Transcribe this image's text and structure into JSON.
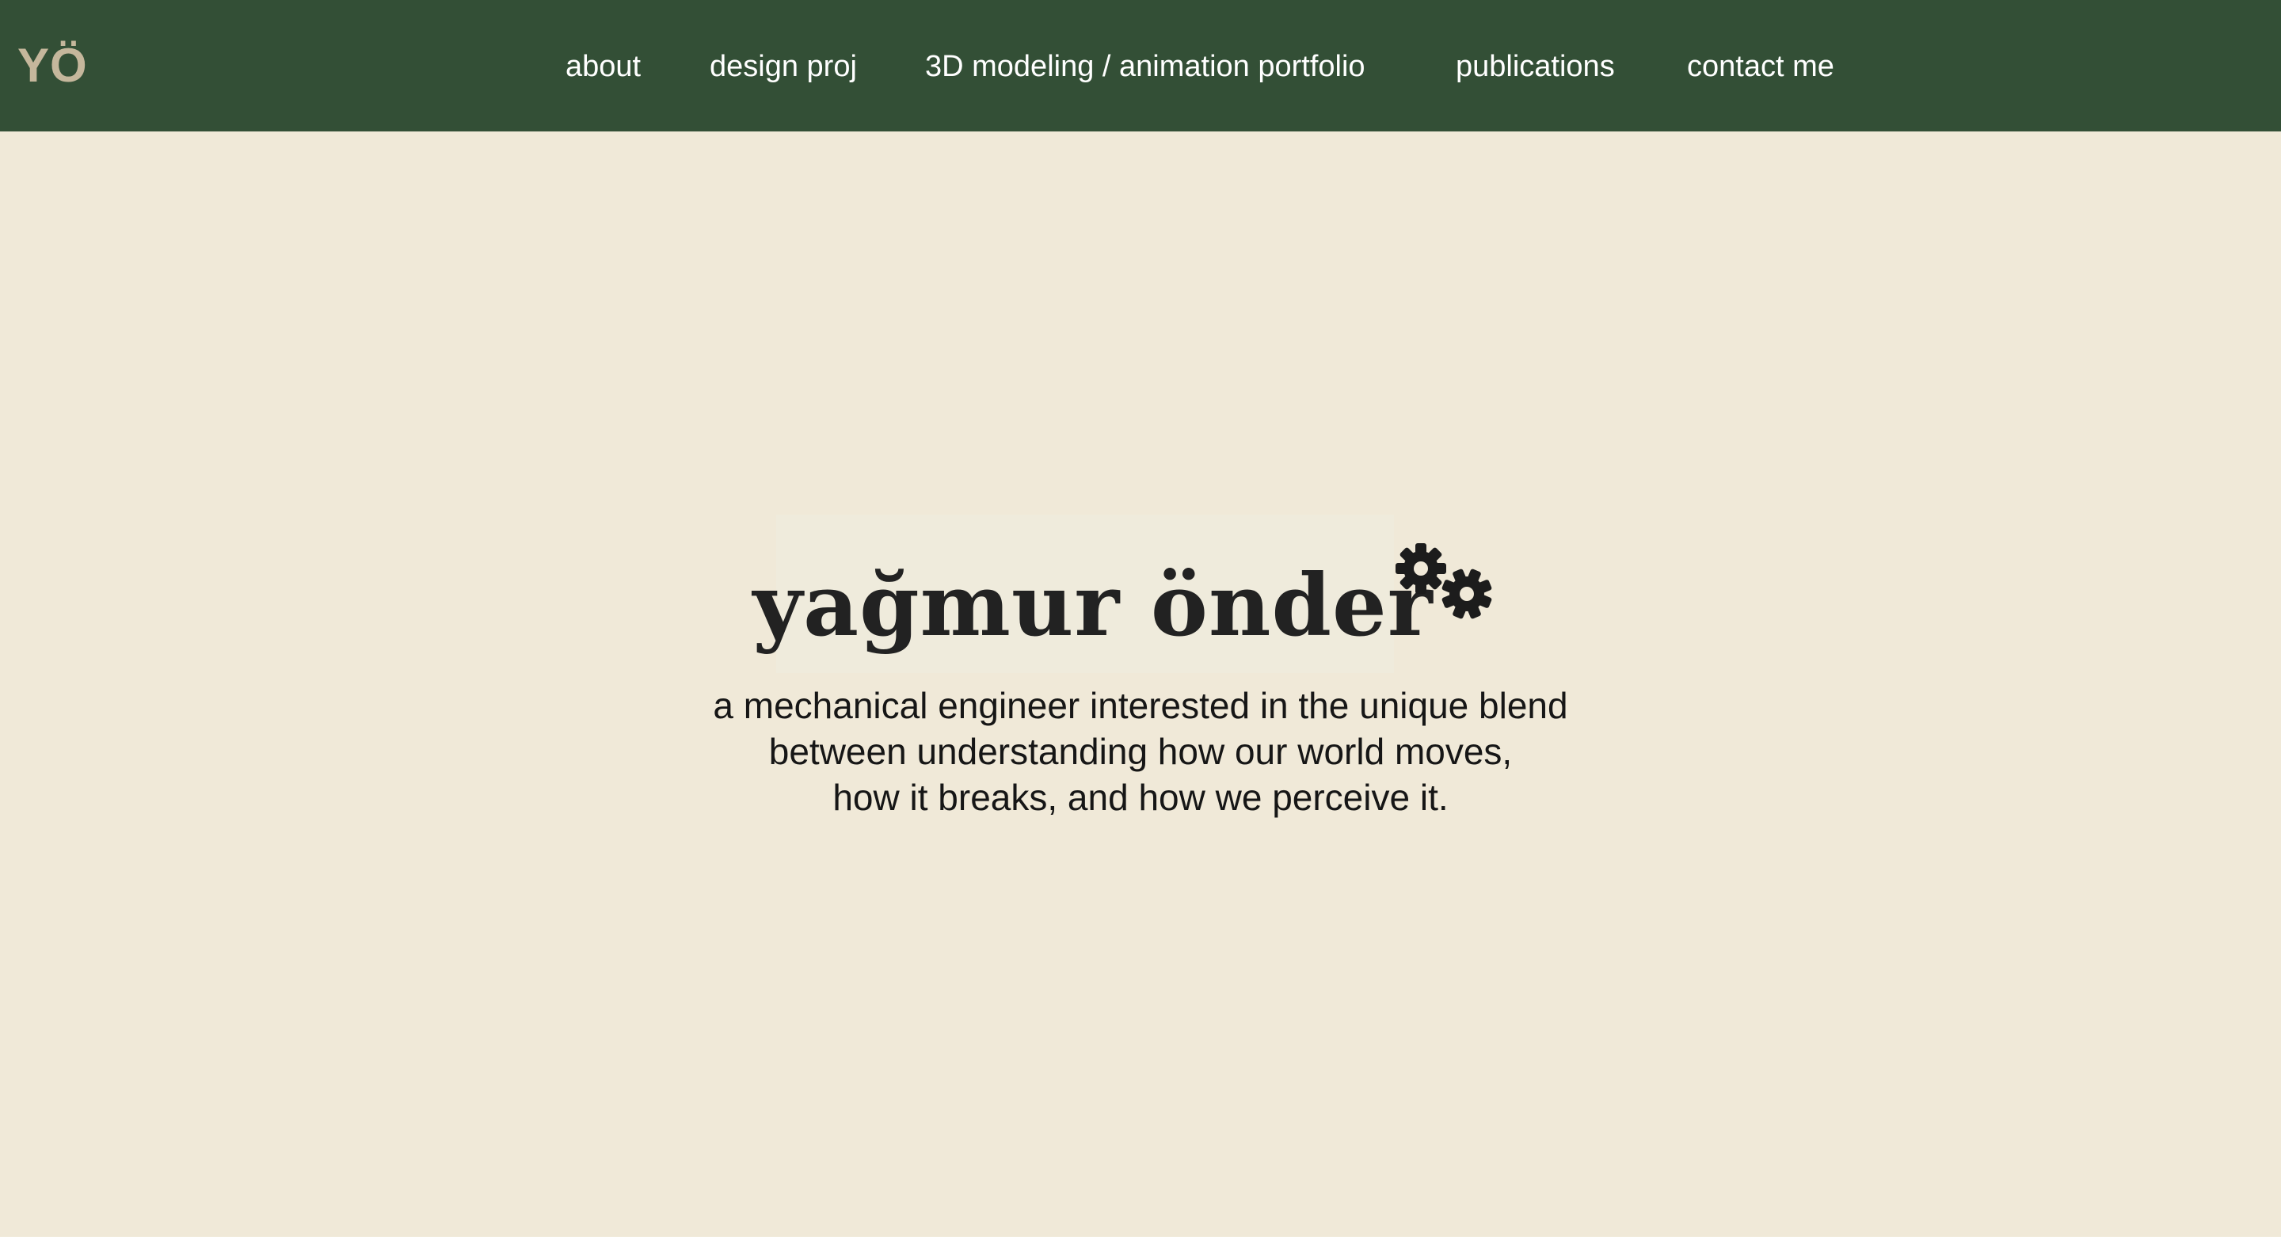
{
  "navbar": {
    "logo": "YÖ",
    "links": [
      {
        "label": "about"
      },
      {
        "label": "design proj"
      },
      {
        "label": "3D modeling / animation portfolio"
      },
      {
        "label": "publications"
      },
      {
        "label": "contact me"
      }
    ]
  },
  "hero": {
    "title": "yağmur önder",
    "icon": "gears-icon",
    "subtitle_lines": [
      "a mechanical engineer interested in the unique blend",
      "between understanding how our world moves,",
      "how it breaks, and how we perceive it."
    ]
  },
  "colors": {
    "navbar_bg": "#334f36",
    "page_bg": "#f0e9d8",
    "logo": "#c5b79c",
    "nav_text": "#ffffff",
    "title_text": "#222222"
  }
}
